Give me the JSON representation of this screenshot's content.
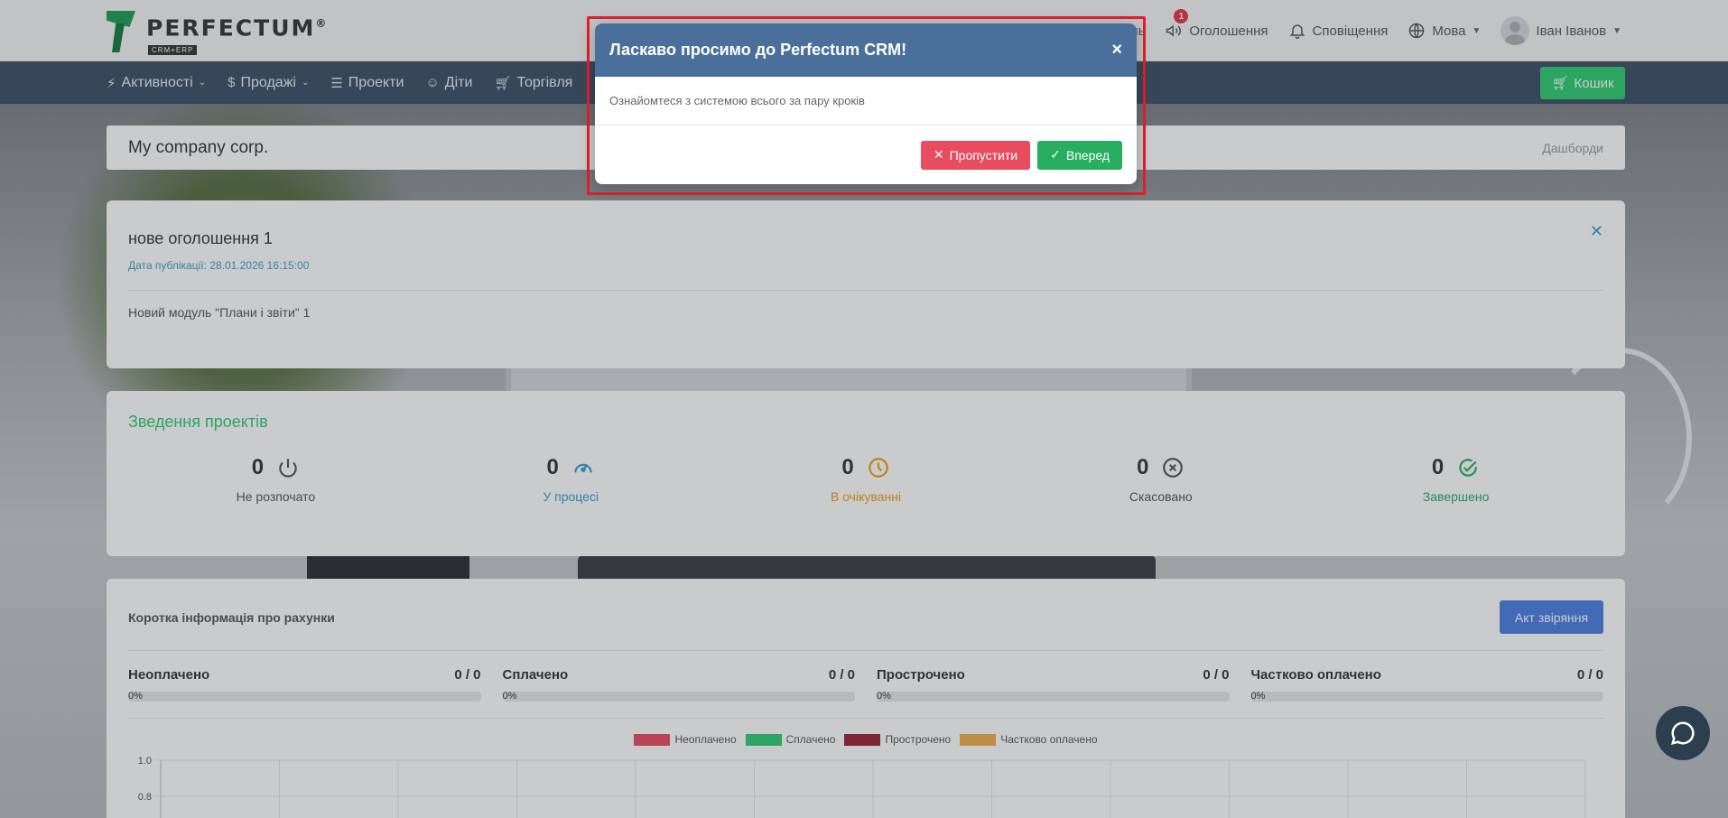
{
  "header": {
    "logo_word": "PERFECTUM",
    "logo_reg": "®",
    "logo_sub": "CRM+ERP",
    "partial_item": "ань",
    "announcements_label": "Оголошення",
    "announcements_badge": "1",
    "notifications_label": "Сповіщення",
    "language_label": "Мова",
    "user_name": "Іван Іванов"
  },
  "nav": {
    "items": [
      {
        "label": "Активності",
        "icon": "bolt-icon"
      },
      {
        "label": "Продажі",
        "icon": "dollar-icon"
      },
      {
        "label": "Проекти",
        "icon": "layers-icon"
      },
      {
        "label": "Діти",
        "icon": "smile-icon"
      },
      {
        "label": "Торгівля",
        "icon": "cart-icon"
      }
    ],
    "cart_label": "Кошик"
  },
  "breadcrumb": {
    "company": "My company corp.",
    "current": "Дашборди"
  },
  "announcement": {
    "title": "нове оголошення 1",
    "date": "Дата публікації: 28.01.2026 16:15:00",
    "body": "Новий модуль \"Плани і звіти\" 1"
  },
  "projects": {
    "title": "Зведення проектів",
    "stats": [
      {
        "value": "0",
        "label": "Не розпочато",
        "color": "#555555",
        "icon": "power-icon"
      },
      {
        "value": "0",
        "label": "У процесі",
        "color": "#3aa0c8",
        "icon": "gauge-icon"
      },
      {
        "value": "0",
        "label": "В очікуванні",
        "color": "#f39c12",
        "icon": "clock-icon"
      },
      {
        "value": "0",
        "label": "Скасовано",
        "color": "#555555",
        "icon": "x-circle-icon"
      },
      {
        "value": "0",
        "label": "Завершено",
        "color": "#27ae60",
        "icon": "check-circle-icon"
      }
    ]
  },
  "invoices": {
    "title": "Коротка інформація про рахунки",
    "act_button": "Акт звіряння",
    "items": [
      {
        "label": "Неоплачено",
        "value": "0 / 0",
        "percent": "0%",
        "fraction": 0,
        "color": "#e84c5f"
      },
      {
        "label": "Сплачено",
        "value": "0 / 0",
        "percent": "0%",
        "fraction": 0,
        "color": "#2ecc71"
      },
      {
        "label": "Прострочено",
        "value": "0 / 0",
        "percent": "0%",
        "fraction": 0,
        "color": "#9b2335"
      },
      {
        "label": "Частково оплачено",
        "value": "0 / 0",
        "percent": "0%",
        "fraction": 0,
        "color": "#f0ad4e"
      }
    ]
  },
  "chart_data": {
    "type": "bar",
    "series": [
      {
        "name": "Неоплачено",
        "color": "#e84c5f",
        "values": []
      },
      {
        "name": "Сплачено",
        "color": "#2ecc71",
        "values": []
      },
      {
        "name": "Прострочено",
        "color": "#9b2335",
        "values": []
      },
      {
        "name": "Частково оплачено",
        "color": "#f0ad4e",
        "values": []
      }
    ],
    "yticks": [
      "1.0",
      "0.8"
    ],
    "ylim": [
      0,
      1.0
    ],
    "grid": true,
    "legend": "top-center"
  },
  "modal": {
    "title": "Ласкаво просимо до Perfectum CRM!",
    "close": "×",
    "body": "Ознайомтеся з системою всього за пару кроків",
    "skip_label": "Пропустити",
    "next_label": "Вперед",
    "skip_color": "#e84c5f",
    "next_color": "#27ae60"
  }
}
